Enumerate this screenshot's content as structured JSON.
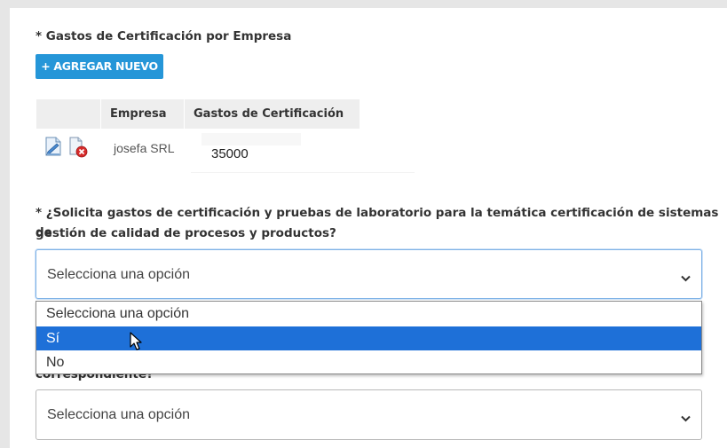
{
  "section1": {
    "label": "* Gastos de Certificación por Empresa",
    "add_button": "+ AGREGAR NUEVO"
  },
  "table": {
    "headers": [
      "Empresa",
      "Gastos de Certificación"
    ],
    "rows": [
      {
        "empresa": "josefa SRL",
        "gastos": "35000"
      }
    ]
  },
  "question1": {
    "label_line1": "* ¿Solicita gastos de certificación y pruebas de laboratorio para la temática certificación de sistemas de",
    "label_line2": "gestión de calidad de procesos y productos?",
    "selected": "Selecciona una opción",
    "options": [
      "Selecciona una opción",
      "Sí",
      "No"
    ],
    "highlighted_option": "Sí"
  },
  "question2": {
    "label_partial": "correspondiente?",
    "selected": "Selecciona una opción"
  },
  "colors": {
    "accent": "#2596d8",
    "highlight": "#1e70d8",
    "background": "#e6e6e6"
  },
  "icons": {
    "edit": "edit-document-icon",
    "delete": "delete-document-icon",
    "chevron": "chevron-down-icon",
    "cursor": "mouse-cursor-icon"
  }
}
